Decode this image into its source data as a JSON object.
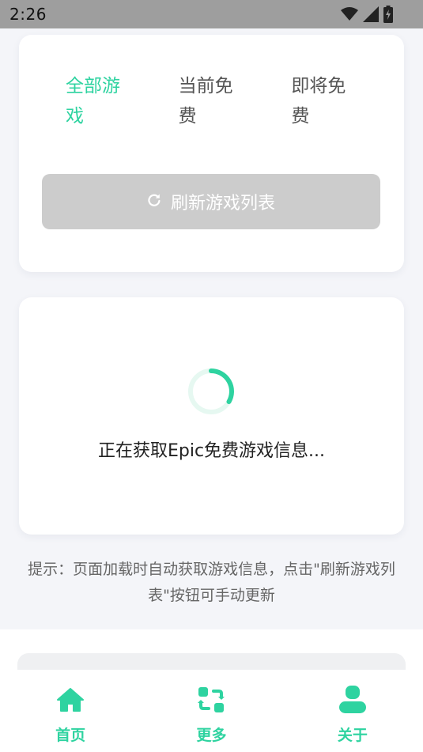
{
  "status_bar": {
    "time": "2:26",
    "icons": [
      "wifi-icon",
      "signal-icon",
      "battery-charging-icon"
    ]
  },
  "tabs": [
    {
      "label": "全部游戏",
      "active": true
    },
    {
      "label": "当前免费",
      "active": false
    },
    {
      "label": "即将免费",
      "active": false
    }
  ],
  "refresh_button": {
    "label": "刷新游戏列表",
    "icon": "refresh-icon",
    "disabled": true
  },
  "loading": {
    "text": "正在获取Epic免费游戏信息..."
  },
  "hint": "提示：页面加载时自动获取游戏信息，点击\"刷新游戏列表\"按钮可手动更新",
  "bottom_nav": [
    {
      "label": "首页",
      "icon": "home-icon"
    },
    {
      "label": "更多",
      "icon": "exchange-icon"
    },
    {
      "label": "关于",
      "icon": "user-icon"
    }
  ],
  "colors": {
    "accent": "#2ed3a0",
    "disabled_button": "#cccccc",
    "background": "#f4f5f9"
  }
}
